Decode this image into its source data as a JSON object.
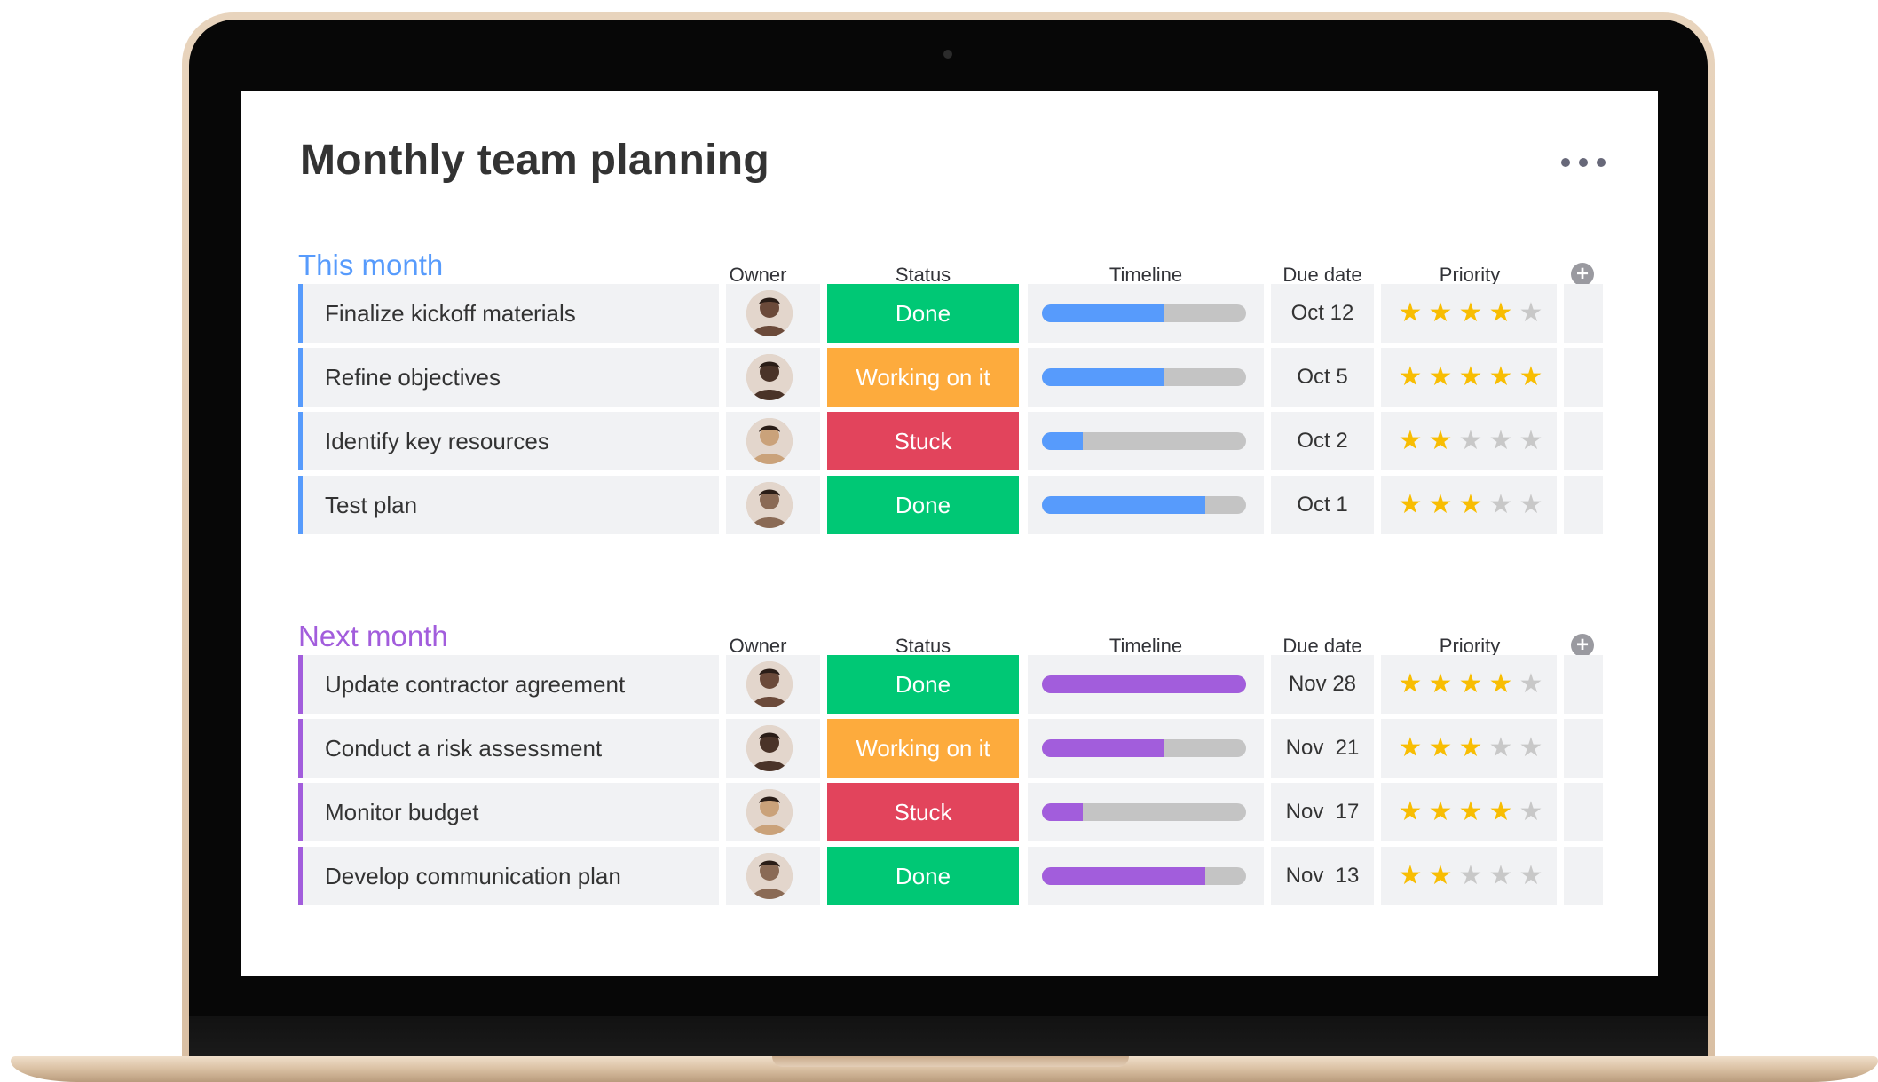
{
  "board": {
    "title": "Monthly team planning",
    "more_icon": "more-horizontal-icon"
  },
  "colors": {
    "done": "#00c875",
    "working": "#fdab3d",
    "stuck": "#e2445c",
    "this_month": "#579bfc",
    "next_month": "#a25ddc",
    "star_on": "#f8bd02",
    "star_off": "#c8c8c8"
  },
  "columns": {
    "owner": "Owner",
    "status": "Status",
    "timeline": "Timeline",
    "due": "Due date",
    "priority": "Priority"
  },
  "groups": [
    {
      "name": "This month",
      "color": "#579bfc",
      "rows": [
        {
          "task": "Finalize kickoff materials",
          "status": "Done",
          "status_color": "#00c875",
          "timeline_progress": 0.6,
          "due": "Oct 12",
          "priority": 4,
          "owner_icon": "avatar-icon"
        },
        {
          "task": "Refine objectives",
          "status": "Working on it",
          "status_color": "#fdab3d",
          "timeline_progress": 0.6,
          "due": "Oct 5",
          "priority": 5,
          "owner_icon": "avatar-icon"
        },
        {
          "task": "Identify key resources",
          "status": "Stuck",
          "status_color": "#e2445c",
          "timeline_progress": 0.2,
          "due": "Oct 2",
          "priority": 2,
          "owner_icon": "avatar-icon"
        },
        {
          "task": "Test plan",
          "status": "Done",
          "status_color": "#00c875",
          "timeline_progress": 0.8,
          "due": "Oct 1",
          "priority": 3,
          "owner_icon": "avatar-icon"
        }
      ]
    },
    {
      "name": "Next month",
      "color": "#a25ddc",
      "rows": [
        {
          "task": "Update contractor agreement",
          "status": "Done",
          "status_color": "#00c875",
          "timeline_progress": 1.0,
          "due": "Nov 28",
          "priority": 4,
          "owner_icon": "avatar-icon"
        },
        {
          "task": "Conduct a risk assessment",
          "status": "Working on it",
          "status_color": "#fdab3d",
          "timeline_progress": 0.6,
          "due": "Nov  21",
          "priority": 3,
          "owner_icon": "avatar-icon"
        },
        {
          "task": "Monitor budget",
          "status": "Stuck",
          "status_color": "#e2445c",
          "timeline_progress": 0.2,
          "due": "Nov  17",
          "priority": 4,
          "owner_icon": "avatar-icon"
        },
        {
          "task": "Develop communication plan",
          "status": "Done",
          "status_color": "#00c875",
          "timeline_progress": 0.8,
          "due": "Nov  13",
          "priority": 2,
          "owner_icon": "avatar-icon"
        }
      ]
    }
  ]
}
